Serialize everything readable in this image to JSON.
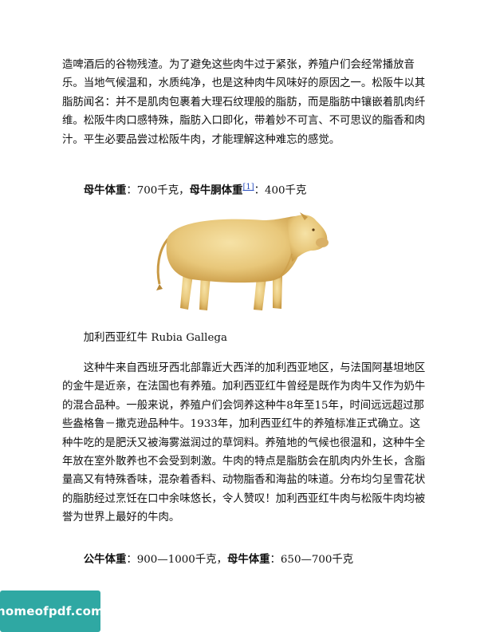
{
  "section1": {
    "paragraph": "造啤酒后的谷物残渣。为了避免这些肉牛过于紧张，养殖户们会经常播放音乐。当地气候温和，水质纯净，也是这种肉牛风味好的原因之一。松阪牛以其脂肪闻名：并不是肌肉包裹着大理石纹理般的脂肪，而是脂肪中镶嵌着肌肉纤维。松阪牛肉口感特殊，脂肪入口即化，带着妙不可言、不可思议的脂香和肉汁。平生必要品尝过松阪牛肉，才能理解这种难忘的感觉。",
    "weight_label_1": "母牛体重",
    "weight_value_1": "：700千克，",
    "weight_label_2": "母牛胴体重",
    "footnote": "[1]",
    "weight_value_2": "：400千克"
  },
  "section2": {
    "title": "加利西亚红牛 Rubia Gallega",
    "paragraph": "这种牛来自西班牙西北部靠近大西洋的加利西亚地区，与法国阿基坦地区的金牛是近亲，在法国也有养殖。加利西亚红牛曾经是既作为肉牛又作为奶牛的混合品种。一般来说，养殖户们会饲养这种牛8年至15年，时间远远超过那些盎格鲁－撒克逊品种牛。1933年，加利西亚红牛的养殖标准正式确立。这种牛吃的是肥沃又被海雾滋润过的草饲料。养殖地的气候也很温和，这种牛全年放在室外散养也不会受到刺激。牛肉的特点是脂肪会在肌肉内外生长，含脂量高又有特殊香味，混杂着香料、动物脂香和海盐的味道。分布均匀呈雪花状的脂肪经过烹饪在口中余味悠长，令人赞叹！加利西亚红牛肉与松阪牛肉均被誉为世界上最好的牛肉。",
    "weight_label_1": "公牛体重",
    "weight_value_1": "：900—1000千克，",
    "weight_label_2": "母牛体重",
    "weight_value_2": "：650—700千克"
  },
  "watermark": {
    "text": "homeofpdf.com"
  },
  "colors": {
    "cow_body": "#e8c77a",
    "footnote_link": "#2a4fbf",
    "badge": "#2fa8a3"
  }
}
